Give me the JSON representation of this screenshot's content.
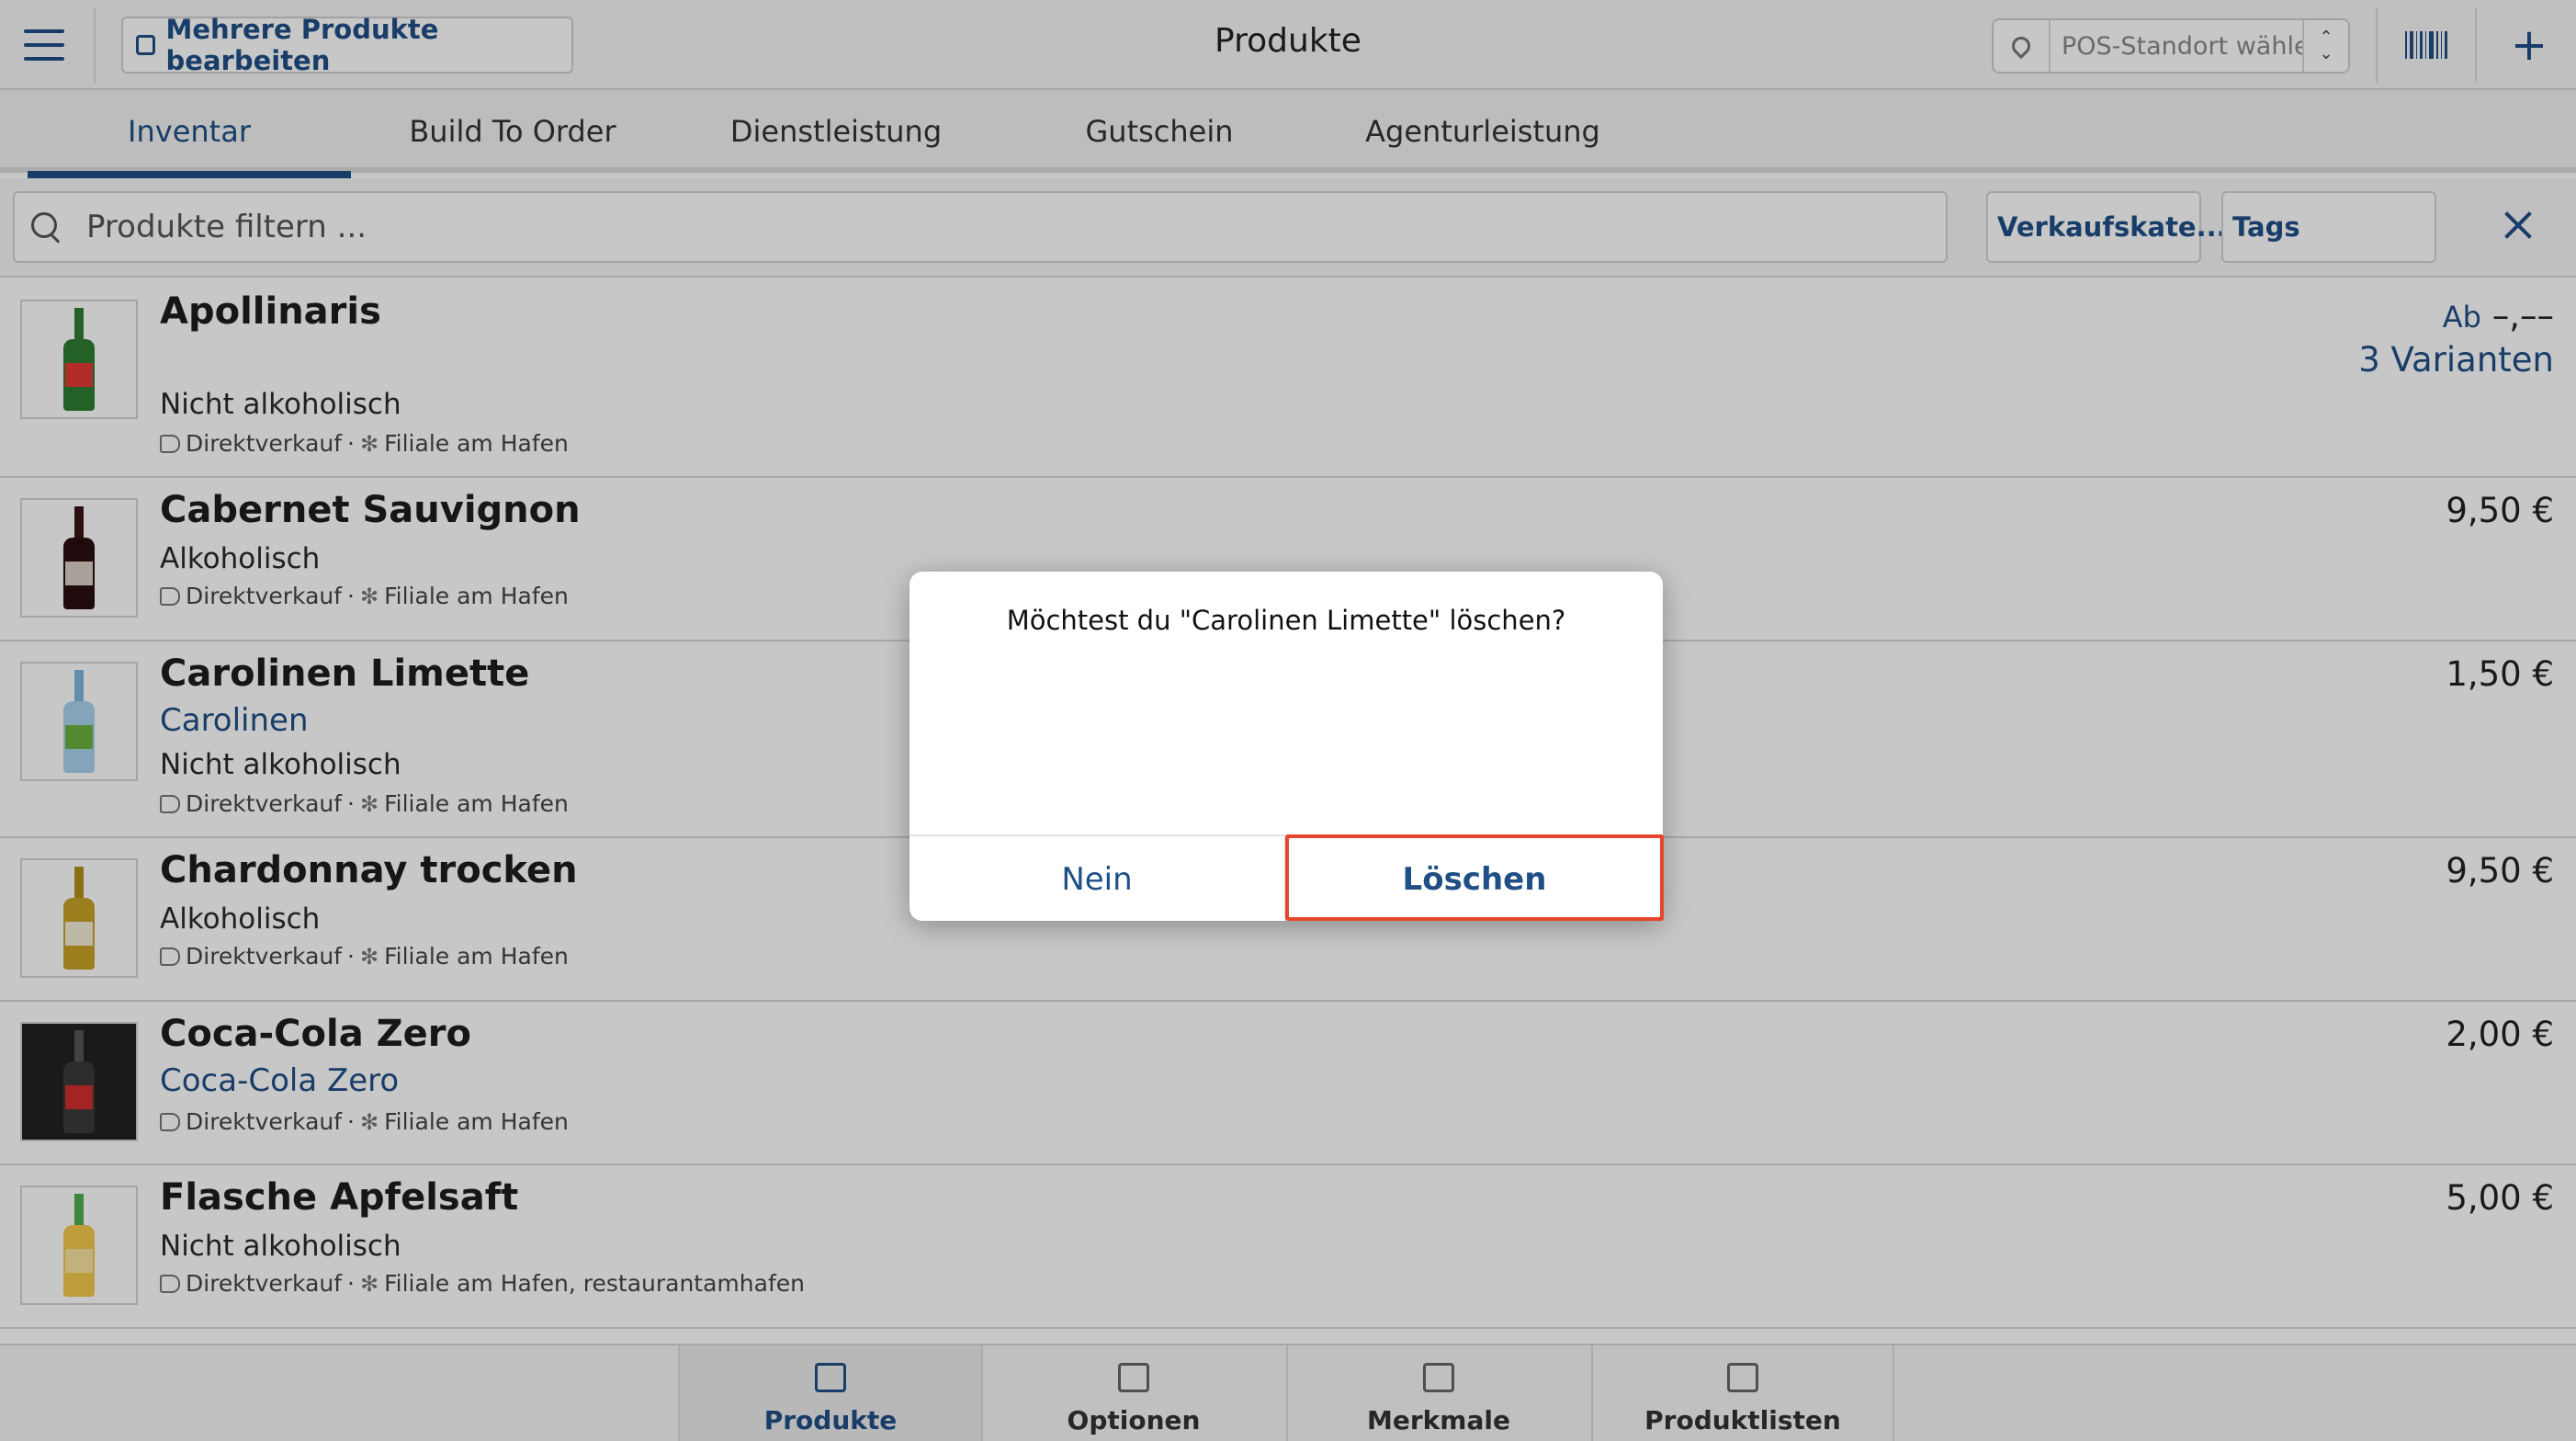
{
  "header": {
    "multi_edit_label": "Mehrere Produkte bearbeiten",
    "title": "Produkte",
    "pos_placeholder": "POS-Standort wählen...",
    "icons": [
      "menu-icon",
      "edit-stack-icon",
      "location-pin-icon",
      "updown-chevron-icon",
      "barcode-icon",
      "plus-icon"
    ]
  },
  "tabs": [
    {
      "label": "Inventar",
      "active": true
    },
    {
      "label": "Build To Order",
      "active": false
    },
    {
      "label": "Dienstleistung",
      "active": false
    },
    {
      "label": "Gutschein",
      "active": false
    },
    {
      "label": "Agenturleistung",
      "active": false
    }
  ],
  "filter": {
    "search_placeholder": "Produkte filtern ...",
    "category_label": "Verkaufskate...",
    "tags_label": "Tags"
  },
  "products": [
    {
      "name": "Apollinaris",
      "subtitle": "",
      "category": "Nicht alkoholisch",
      "channels": "Direktverkauf",
      "locations": "Filiale am Hafen",
      "price_prefix": "Ab",
      "price": "–,––",
      "variants": "3 Varianten"
    },
    {
      "name": "Cabernet Sauvignon",
      "subtitle": "",
      "category": "Alkoholisch",
      "channels": "Direktverkauf",
      "locations": "Filiale am Hafen",
      "price": "9,50 €"
    },
    {
      "name": "Carolinen Limette",
      "subtitle": "Carolinen",
      "category": "Nicht alkoholisch",
      "channels": "Direktverkauf",
      "locations": "Filiale am Hafen",
      "price": "1,50 €"
    },
    {
      "name": "Chardonnay trocken",
      "subtitle": "",
      "category": "Alkoholisch",
      "channels": "Direktverkauf",
      "locations": "Filiale am Hafen",
      "price": "9,50 €"
    },
    {
      "name": "Coca-Cola Zero",
      "subtitle": "Coca-Cola Zero",
      "category": "",
      "channels": "Direktverkauf",
      "locations": "Filiale am Hafen",
      "price": "2,00 €"
    },
    {
      "name": "Flasche Apfelsaft",
      "subtitle": "",
      "category": "Nicht alkoholisch",
      "channels": "Direktverkauf",
      "locations": "Filiale am Hafen, restaurantamhafen",
      "price": "5,00 €"
    }
  ],
  "meta_separator": "·",
  "bottom_nav": [
    {
      "label": "Produkte",
      "icon": "products-icon",
      "active": true
    },
    {
      "label": "Optionen",
      "icon": "sliders-icon",
      "active": false
    },
    {
      "label": "Merkmale",
      "icon": "attributes-icon",
      "active": false
    },
    {
      "label": "Produktlisten",
      "icon": "product-lists-icon",
      "active": false
    }
  ],
  "dialog": {
    "message": "Möchtest du \"Carolinen Limette\" löschen?",
    "cancel_label": "Nein",
    "confirm_label": "Löschen"
  },
  "colors": {
    "accent": "#1f4f86",
    "highlight": "#e8452e"
  }
}
